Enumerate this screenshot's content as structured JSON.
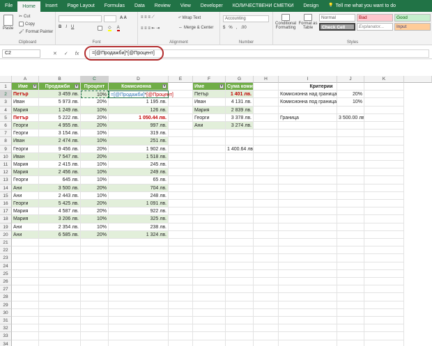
{
  "tabs": [
    "File",
    "Home",
    "Insert",
    "Page Layout",
    "Formulas",
    "Data",
    "Review",
    "View",
    "Developer",
    "КОЛИЧЕСТВЕНИ СМЕТКИ",
    "Design"
  ],
  "active_tab": "Home",
  "tell_me": "Tell me what you want to do",
  "ribbon": {
    "paste": "Paste",
    "cut": "Cut",
    "copy": "Copy",
    "format_painter": "Format Painter",
    "clipboard": "Clipboard",
    "font": "Font",
    "wrap_text": "Wrap Text",
    "merge_center": "Merge & Center",
    "alignment": "Alignment",
    "number_format": "Accounting",
    "number": "Number",
    "conditional_formatting": "Conditional Formatting",
    "format_as_table": "Format as Table",
    "styles": "Styles",
    "style_cells": [
      "Normal",
      "Bad",
      "Good",
      "Check Cell",
      "Explanator...",
      "Input"
    ]
  },
  "formula_bar": {
    "name_box": "C2",
    "formula": "=[@Продажби]*[@Процент]"
  },
  "grid": {
    "columns": [
      "A",
      "B",
      "C",
      "D",
      "E",
      "F",
      "G",
      "H",
      "I",
      "J",
      "K"
    ],
    "rows": [
      "1",
      "2",
      "3",
      "4",
      "5",
      "6",
      "7",
      "8",
      "9",
      "10",
      "11",
      "12",
      "13",
      "14",
      "15",
      "16",
      "17",
      "18",
      "19",
      "20",
      "21",
      "22",
      "23",
      "24",
      "25",
      "26",
      "27",
      "28",
      "29",
      "30",
      "31",
      "32",
      "33",
      "34"
    ],
    "table1_headers": [
      "Име",
      "Продажби",
      "Процент",
      "Комисионна"
    ],
    "table1_rows": [
      [
        "Петър",
        "3 459 лв.",
        "",
        "=[@Продажби]*[@Процент]"
      ],
      [
        "Иван",
        "5 973 лв.",
        "20%",
        "1 195 лв."
      ],
      [
        "Мария",
        "1 249 лв.",
        "10%",
        "126 лв."
      ],
      [
        "Петър",
        "5 222 лв.",
        "20%",
        "1 050.44 лв."
      ],
      [
        "Георги",
        "4 955 лв.",
        "20%",
        "997 лв."
      ],
      [
        "Георги",
        "3 154 лв.",
        "10%",
        "319 лв."
      ],
      [
        "Иван",
        "2 474 лв.",
        "10%",
        "251 лв."
      ],
      [
        "Георги",
        "9 456 лв.",
        "20%",
        "1 902 лв."
      ],
      [
        "Иван",
        "7 547 лв.",
        "20%",
        "1 518 лв."
      ],
      [
        "Мария",
        "2 415 лв.",
        "10%",
        "245 лв."
      ],
      [
        "Мария",
        "2 456 лв.",
        "10%",
        "249 лв."
      ],
      [
        "Георги",
        "645 лв.",
        "10%",
        "65 лв."
      ],
      [
        "Ани",
        "3 500 лв.",
        "20%",
        "704 лв."
      ],
      [
        "Ани",
        "2 443 лв.",
        "10%",
        "248 лв."
      ],
      [
        "Георги",
        "5 425 лв.",
        "20%",
        "1 091 лв."
      ],
      [
        "Мария",
        "4 587 лв.",
        "20%",
        "922 лв."
      ],
      [
        "Мария",
        "3 206 лв.",
        "10%",
        "325 лв."
      ],
      [
        "Ани",
        "2 354 лв.",
        "10%",
        "238 лв."
      ],
      [
        "Ани",
        "6 585 лв.",
        "20%",
        "1 324 лв."
      ]
    ],
    "c2_partial": "10%",
    "table2_headers": [
      "Име",
      "Сума комисионна"
    ],
    "table2_rows": [
      [
        "Петър",
        "1 401 лв."
      ],
      [
        "Иван",
        "4 131 лв."
      ],
      [
        "Мария",
        "2 839 лв."
      ],
      [
        "Георги",
        "3 378 лв."
      ],
      [
        "Ани",
        "3 274 лв."
      ]
    ],
    "g9": "1 400.64 лв.",
    "criteria": {
      "title": "Критерии",
      "rows": [
        [
          "Комисионна над граница",
          "20%"
        ],
        [
          "Комисионна под граница",
          "10%"
        ],
        [
          "",
          ""
        ],
        [
          "Граница",
          "3 500.00 лв."
        ]
      ]
    }
  }
}
